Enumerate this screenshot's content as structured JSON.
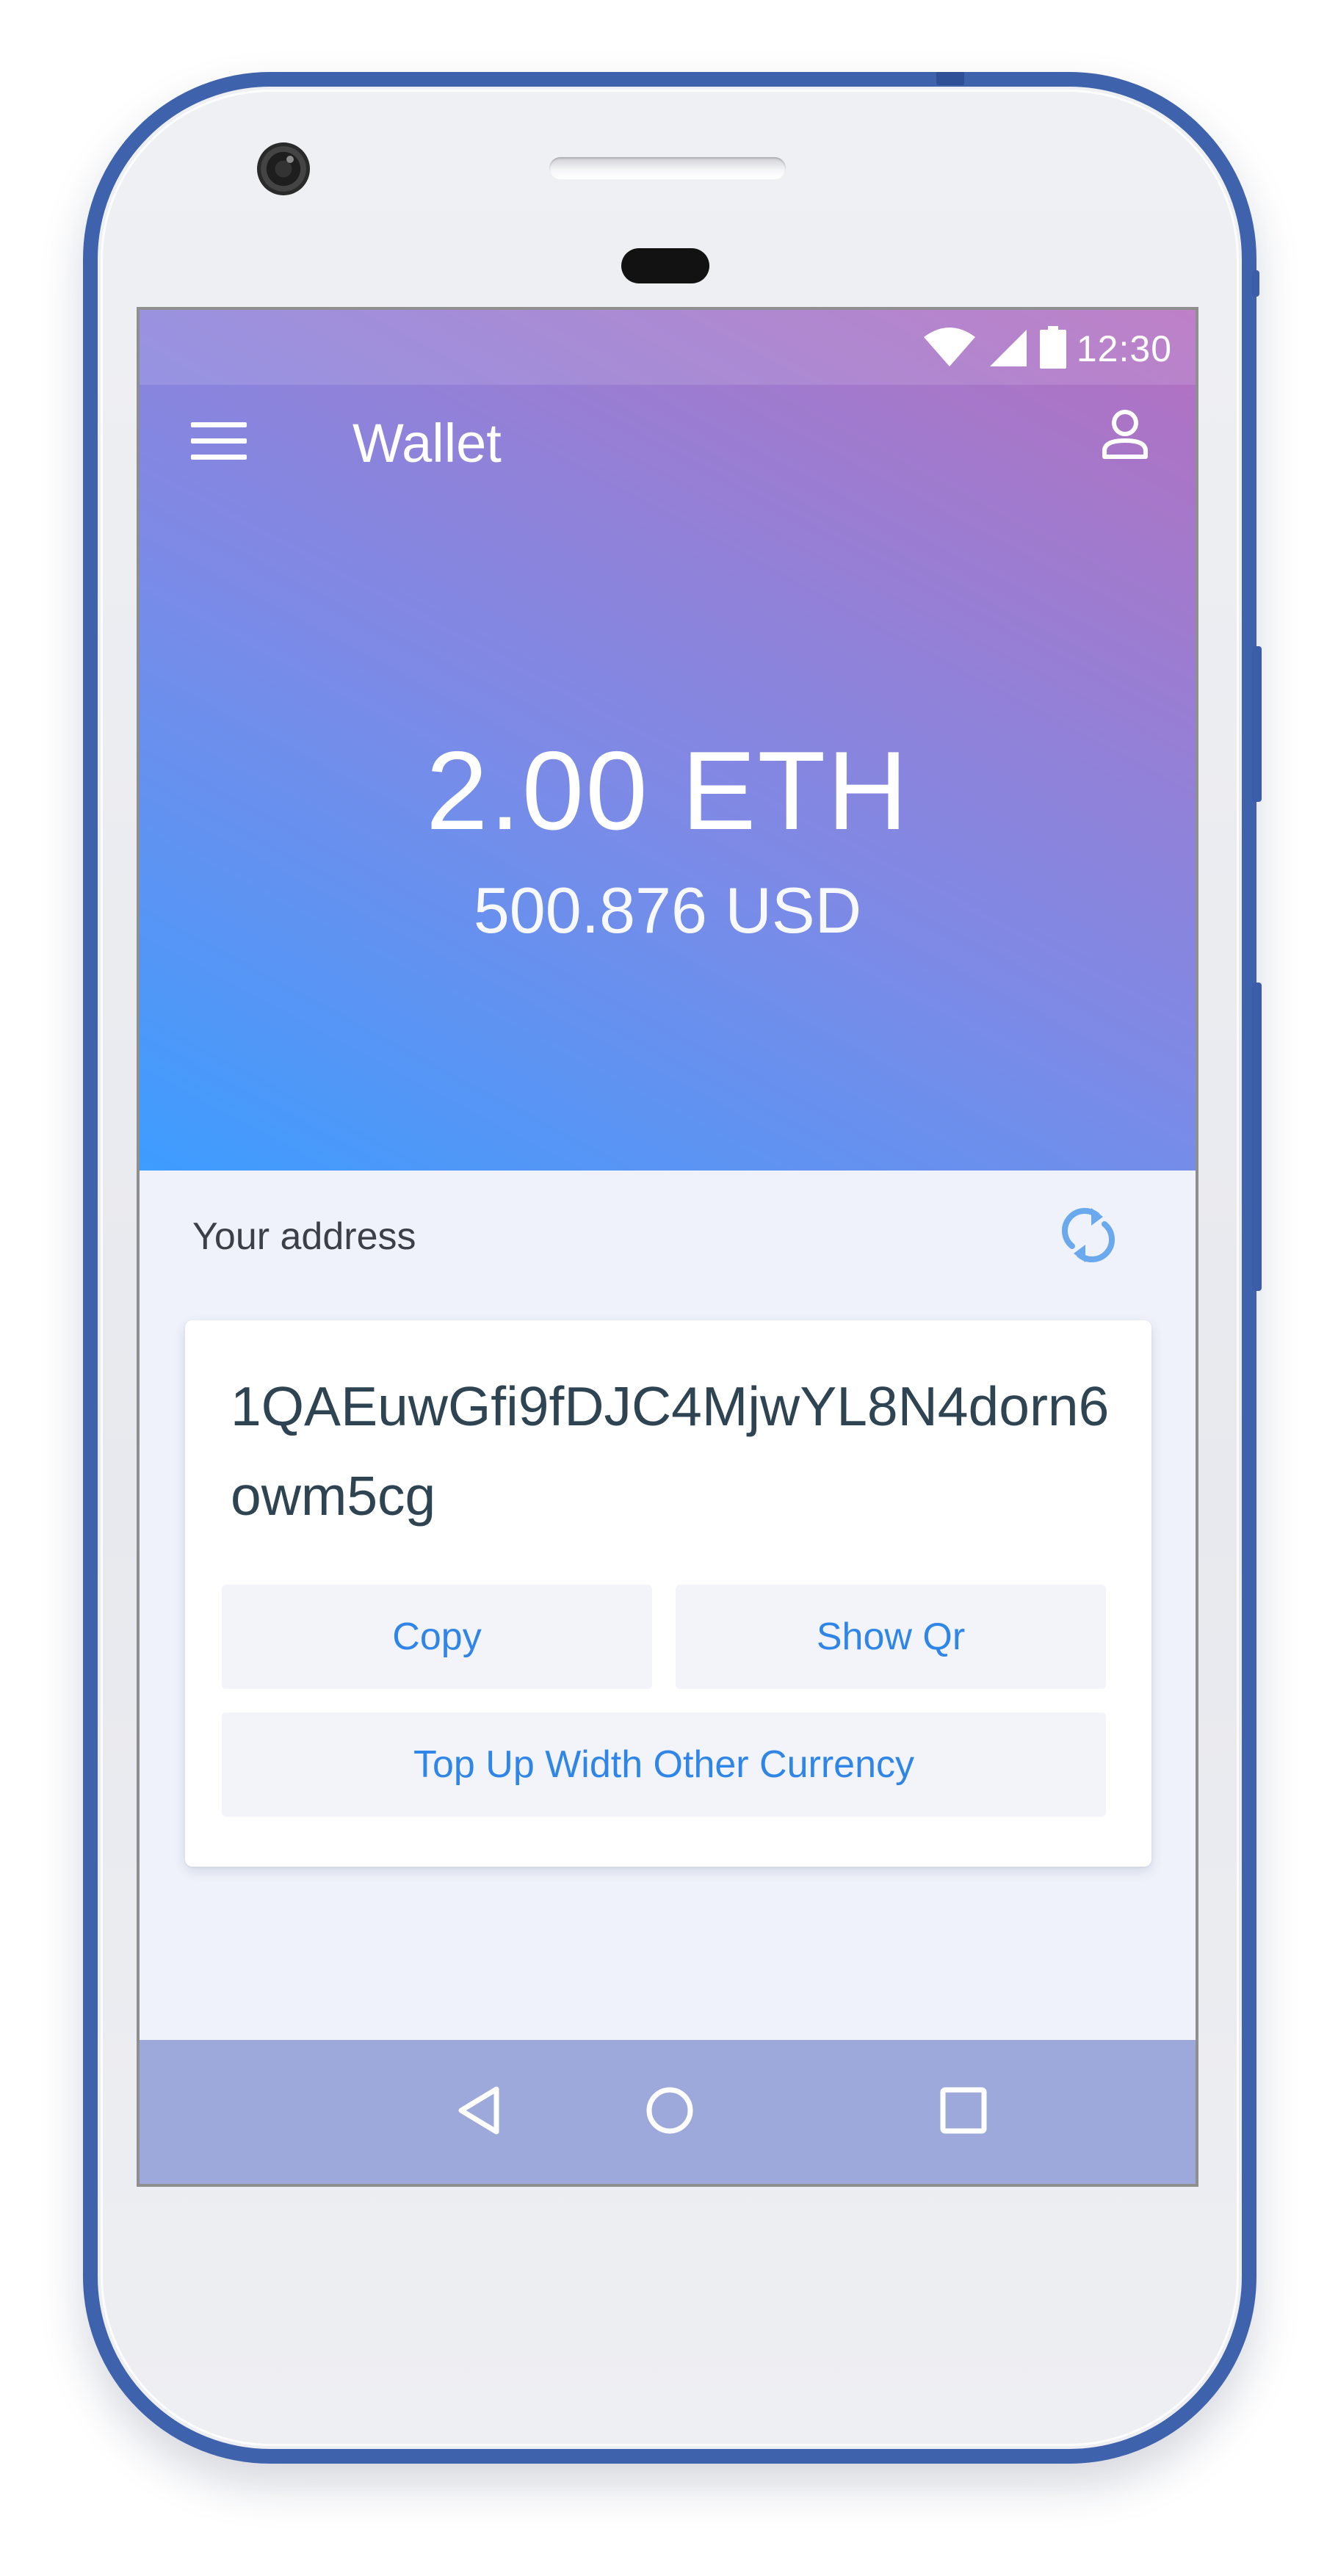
{
  "status_bar": {
    "time": "12:30",
    "icons": [
      "wifi-icon",
      "cellular-signal-icon",
      "battery-icon"
    ]
  },
  "toolbar": {
    "title": "Wallet",
    "menu_icon": "menu-icon",
    "profile_icon": "user-icon"
  },
  "balance": {
    "primary": "2.00 ETH",
    "secondary": "500.876 USD"
  },
  "address_section": {
    "label": "Your address",
    "refresh_icon": "refresh-icon",
    "address": "1QAEuwGfi9fDJC4MjwYL8N4dorn6owm5cg"
  },
  "actions": {
    "copy": "Copy",
    "show_qr": "Show Qr",
    "top_up": "Top Up Width Other Currency"
  },
  "nav_bar": {
    "icons": [
      "back-icon",
      "home-icon",
      "recents-icon"
    ]
  },
  "colors": {
    "gradient_start": "#3d9dff",
    "gradient_end": "#b56fc0",
    "accent": "#2f86e8",
    "phone_frame": "#3f62ad",
    "nav_bar": "#9da9db",
    "screen_background": "#eff2fa"
  }
}
